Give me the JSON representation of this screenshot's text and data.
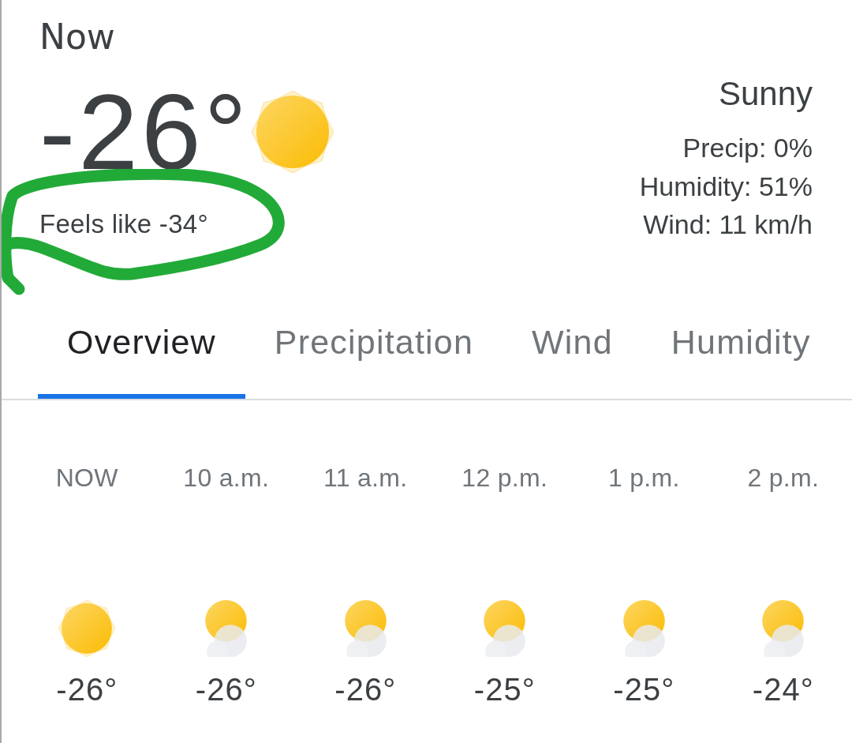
{
  "current": {
    "label": "Now",
    "temperature": "-26°",
    "icon": {
      "kind": "sunny"
    },
    "feels_like": "Feels like -34°"
  },
  "annotation": {
    "kind": "freehand_loop"
  },
  "summary": {
    "condition_text": "Sunny",
    "details": [
      "Precip: 0%",
      "Humidity: 51%",
      "Wind: 11 km/h"
    ]
  },
  "tabs": [
    {
      "label": "Overview",
      "selected": true
    },
    {
      "label": "Precipitation",
      "selected": false
    },
    {
      "label": "Wind",
      "selected": false
    },
    {
      "label": "Humidity",
      "selected": false
    }
  ],
  "hourly": [
    {
      "time": "NOW",
      "kind": "sunny",
      "temperature": "-26°"
    },
    {
      "time": "10 a.m.",
      "kind": "mostly_sunny",
      "temperature": "-26°"
    },
    {
      "time": "11 a.m.",
      "kind": "mostly_sunny",
      "temperature": "-26°"
    },
    {
      "time": "12 p.m.",
      "kind": "mostly_sunny",
      "temperature": "-25°"
    },
    {
      "time": "1 p.m.",
      "kind": "mostly_sunny",
      "temperature": "-25°"
    },
    {
      "time": "2 p.m.",
      "kind": "mostly_sunny",
      "temperature": "-24°"
    }
  ]
}
